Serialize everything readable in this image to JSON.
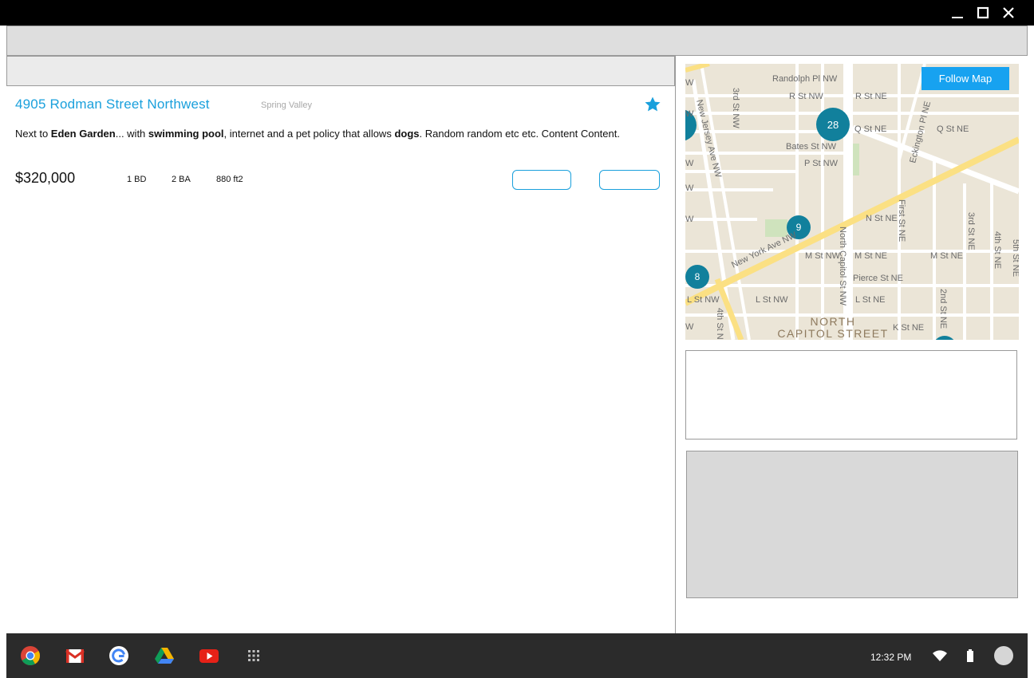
{
  "listing": {
    "title": "4905 Rodman Street Northwest",
    "neighborhood": "Spring Valley",
    "desc_1": "Next to ",
    "desc_2": "Eden Garden",
    "desc_3": "... with ",
    "desc_4": "swimming pool",
    "desc_5": ", internet and a  pet policy that allows ",
    "desc_6": "dogs",
    "desc_7": ". Random random etc etc. Content Content.",
    "price": "$320,000",
    "bedrooms": "1 BD",
    "bathrooms": "2 BA",
    "area": "880 ft2"
  },
  "map": {
    "follow_label": "Follow Map",
    "clusters": [
      "28",
      "9",
      "8"
    ],
    "streets": {
      "randolph": "Randolph Pl NW",
      "r_nw": "R St NW",
      "r_ne": "R St NE",
      "q_ne": "Q St NE",
      "q_ne2": "Q St NE",
      "bates": "Bates St NW",
      "p_nw": "P St NW",
      "n_ne": "N St NE",
      "m_nw": "M St NW",
      "m_ne": "M St NE",
      "m_ne2": "M St NE",
      "pierce": "Pierce St NE",
      "l_nw": "L St NW",
      "l_nw2": "L St NW",
      "l_ne": "L St NE",
      "k_ne": "K St NE",
      "nj": "New Jersey Ave NW",
      "third_nw": "3rd St NW",
      "fourth_nw": "4th St N",
      "ny": "New York Ave NW",
      "ncap": "North Capitol St NW",
      "first_ne": "First St NE",
      "second_ne": "2nd St NE",
      "third_ne": "3rd St NE",
      "fourth_ne": "4th St NE",
      "fifth_ne": "5th St NE",
      "eckington": "Eckington Pl NE",
      "w1": "W",
      "w2": "W",
      "w3": "W",
      "w4": "W",
      "w5": "W",
      "w6": "W"
    },
    "district_1": "NORTH",
    "district_2": "CAPITOL STREET"
  },
  "shelf": {
    "time": "12:32 PM"
  },
  "colors": {
    "accent": "#1aa0dc",
    "follow_button": "#17a2f0",
    "cluster": "#11809c",
    "title_bar": "#000000",
    "shelf": "#2b2b2b"
  }
}
